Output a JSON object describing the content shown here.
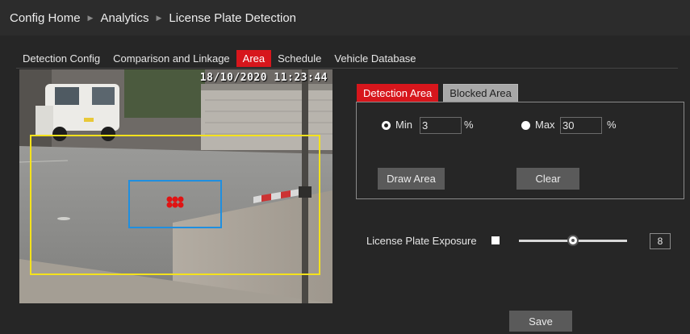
{
  "breadcrumb": {
    "items": [
      "Config Home",
      "Analytics",
      "License Plate Detection"
    ]
  },
  "tabs": [
    {
      "label": "Detection Config",
      "active": false
    },
    {
      "label": "Comparison and Linkage",
      "active": false
    },
    {
      "label": "Area",
      "active": true
    },
    {
      "label": "Schedule",
      "active": false
    },
    {
      "label": "Vehicle Database",
      "active": false
    }
  ],
  "video": {
    "timestamp": "18/10/2020 11:23:44"
  },
  "area_tabs": [
    {
      "label": "Detection Area",
      "active": true
    },
    {
      "label": "Blocked Area",
      "active": false
    }
  ],
  "size": {
    "min_label": "Min",
    "min_value": "3",
    "min_unit": "%",
    "max_label": "Max",
    "max_value": "30",
    "max_unit": "%",
    "selected": "min"
  },
  "buttons": {
    "draw_area": "Draw Area",
    "clear": "Clear",
    "save": "Save"
  },
  "exposure": {
    "label": "License Plate Exposure",
    "checked": false,
    "slider_fraction": 0.5,
    "value": "8"
  },
  "colors": {
    "accent": "#d7161c",
    "detection_region": "#f4e21c",
    "plate_region": "#1f8fe0",
    "marker": "#e01313"
  }
}
